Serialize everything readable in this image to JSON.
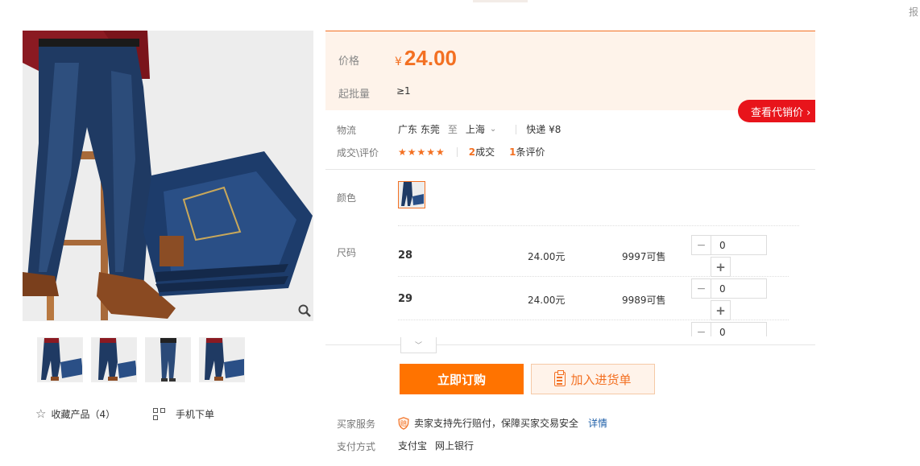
{
  "top": {
    "report": "报"
  },
  "gallery": {
    "thumb_count": 4,
    "favorite_label": "收藏产品（4）",
    "mobile_label": "手机下单"
  },
  "price": {
    "label": "价格",
    "currency": "¥",
    "value": "24.00",
    "moq_label": "起批量",
    "moq_value": "≥1",
    "agent_button": "查看代销价 ›"
  },
  "logistics": {
    "label": "物流",
    "from": "广东 东莞",
    "to_word": "至",
    "to": "上海",
    "express": "快递 ¥8"
  },
  "rating": {
    "label": "成交\\评价",
    "stars": "★★★★★",
    "deals_count": "2",
    "deals_word": "成交",
    "reviews_count": "1",
    "reviews_word": "条评价"
  },
  "color": {
    "label": "颜色"
  },
  "size": {
    "label": "尺码",
    "rows": [
      {
        "name": "28",
        "price": "24.00元",
        "stock": "9997可售",
        "qty": "0"
      },
      {
        "name": "29",
        "price": "24.00元",
        "stock": "9989可售",
        "qty": "0"
      },
      {
        "name": "",
        "price": "",
        "stock": "",
        "qty": "0"
      }
    ]
  },
  "actions": {
    "buy": "立即订购",
    "cart": "加入进货单"
  },
  "service": {
    "label": "买家服务",
    "text": "卖家支持先行赔付，保障买家交易安全",
    "link": "详情"
  },
  "payment": {
    "label": "支付方式",
    "methods": [
      "支付宝",
      "网上银行"
    ]
  },
  "colors": {
    "accent": "#f37022",
    "red": "#e8141b",
    "buy": "#ff7300",
    "link": "#1f5fa8"
  }
}
